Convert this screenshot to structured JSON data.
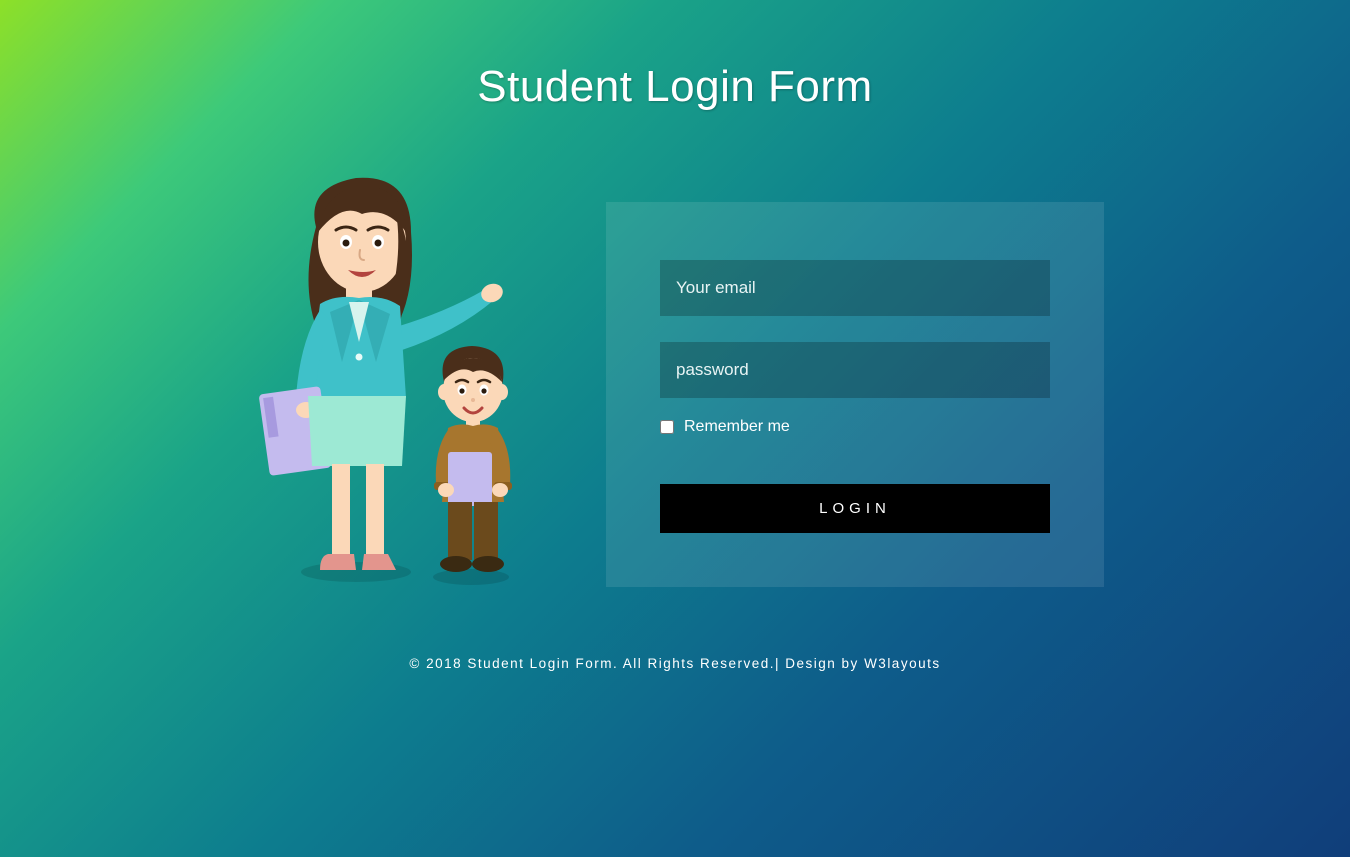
{
  "title": "Student Login Form",
  "form": {
    "email_placeholder": "Your email",
    "password_placeholder": "password",
    "remember_label": "Remember me",
    "login_button": "LOGIN"
  },
  "footer": {
    "text_before": "© 2018 Student Login Form. All Rights Reserved.| Design by ",
    "link_text": "W3layouts"
  }
}
